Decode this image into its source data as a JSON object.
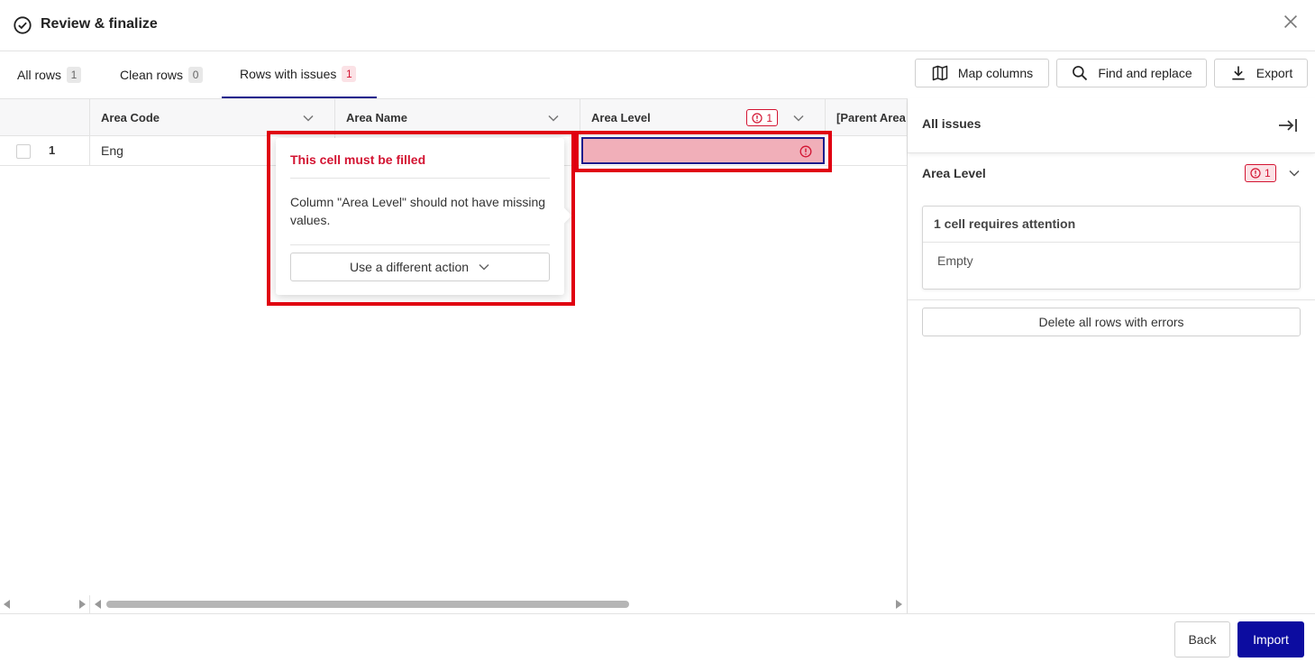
{
  "header": {
    "title": "Review & finalize",
    "title_icon": "check-circle-icon",
    "close_icon": "close-icon"
  },
  "tabs": [
    {
      "label": "All rows",
      "count": "1"
    },
    {
      "label": "Clean rows",
      "count": "0"
    },
    {
      "label": "Rows with issues",
      "count": "1",
      "active": true
    }
  ],
  "toolbar": {
    "map_columns": "Map columns",
    "find_replace": "Find and replace",
    "export": "Export"
  },
  "grid": {
    "columns": [
      {
        "label": "Area Code"
      },
      {
        "label": "Area Name"
      },
      {
        "label": "Area Level",
        "error_count": "1"
      },
      {
        "label": "[Parent Area C"
      }
    ],
    "rows": [
      {
        "number": "1",
        "area_code": "Eng",
        "area_name": "",
        "area_level": ""
      }
    ]
  },
  "popover": {
    "title": "This cell must be filled",
    "message": "Column \"Area Level\" should not have missing values.",
    "action_label": "Use a different action"
  },
  "panel": {
    "title": "All issues",
    "group_title": "Area Level",
    "group_count": "1",
    "card_title": "1 cell requires attention",
    "card_value": "Empty",
    "delete_label": "Delete all rows with errors"
  },
  "footer": {
    "back": "Back",
    "import": "Import"
  },
  "colors": {
    "accent": "#1c1c8c",
    "primary_button": "#0c0ca0",
    "error": "#d31432",
    "error_cell": "#f1afb9",
    "highlight": "#e00010"
  }
}
